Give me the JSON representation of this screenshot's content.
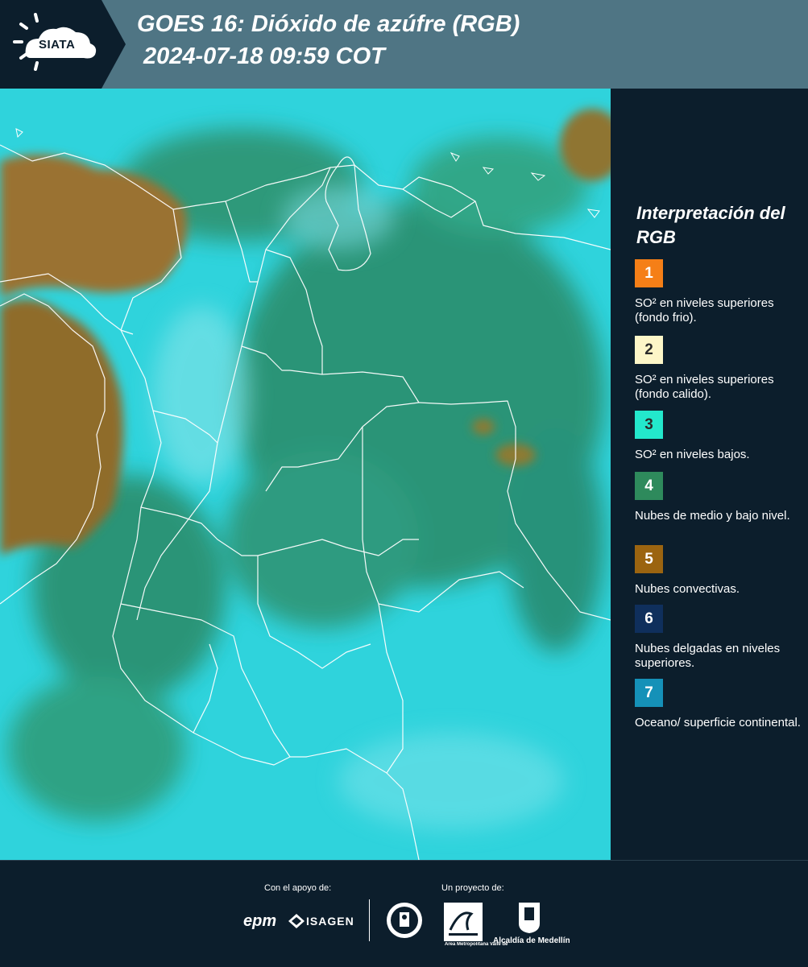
{
  "header": {
    "logo_text": "SIATA",
    "title_line1": "GOES 16: Dióxido de azúfre (RGB)",
    "title_line2": "2024-07-18 09:59 COT"
  },
  "legend": {
    "title": "Interpretación del RGB",
    "items": [
      {
        "number": "1",
        "color": "#f57f17",
        "text_color": "#ffffff",
        "label": "SO² en niveles superiores (fondo frio)."
      },
      {
        "number": "2",
        "color": "#fdf6c8",
        "text_color": "#2b2b2b",
        "label": "SO² en niveles superiores (fondo calido)."
      },
      {
        "number": "3",
        "color": "#23e8cc",
        "text_color": "#2b2b2b",
        "label": "SO² en niveles bajos."
      },
      {
        "number": "4",
        "color": "#2e8a5c",
        "text_color": "#ffffff",
        "label": "Nubes de medio y bajo nivel."
      },
      {
        "number": "5",
        "color": "#9b6410",
        "text_color": "#ffffff",
        "label": "Nubes convectivas."
      },
      {
        "number": "6",
        "color": "#0f2f5c",
        "text_color": "#ffffff",
        "label": "Nubes delgadas en niveles superiores."
      },
      {
        "number": "7",
        "color": "#1591b8",
        "text_color": "#ffffff",
        "label": "Oceano/ superficie continental."
      }
    ]
  },
  "footer": {
    "support_label": "Con el apoyo de:",
    "project_label": "Un proyecto de:",
    "sponsors": [
      "epm",
      "ISAGEN"
    ],
    "partners": [
      "Área Metropolitana Valle de Aburrá",
      "Alcaldía de Medellín"
    ]
  },
  "colors": {
    "background": "#0c1e2c",
    "header": "#4f7584",
    "map_cyan": "#2fd3dc",
    "map_green": "#2a8a66",
    "map_brown": "#9a7230"
  }
}
